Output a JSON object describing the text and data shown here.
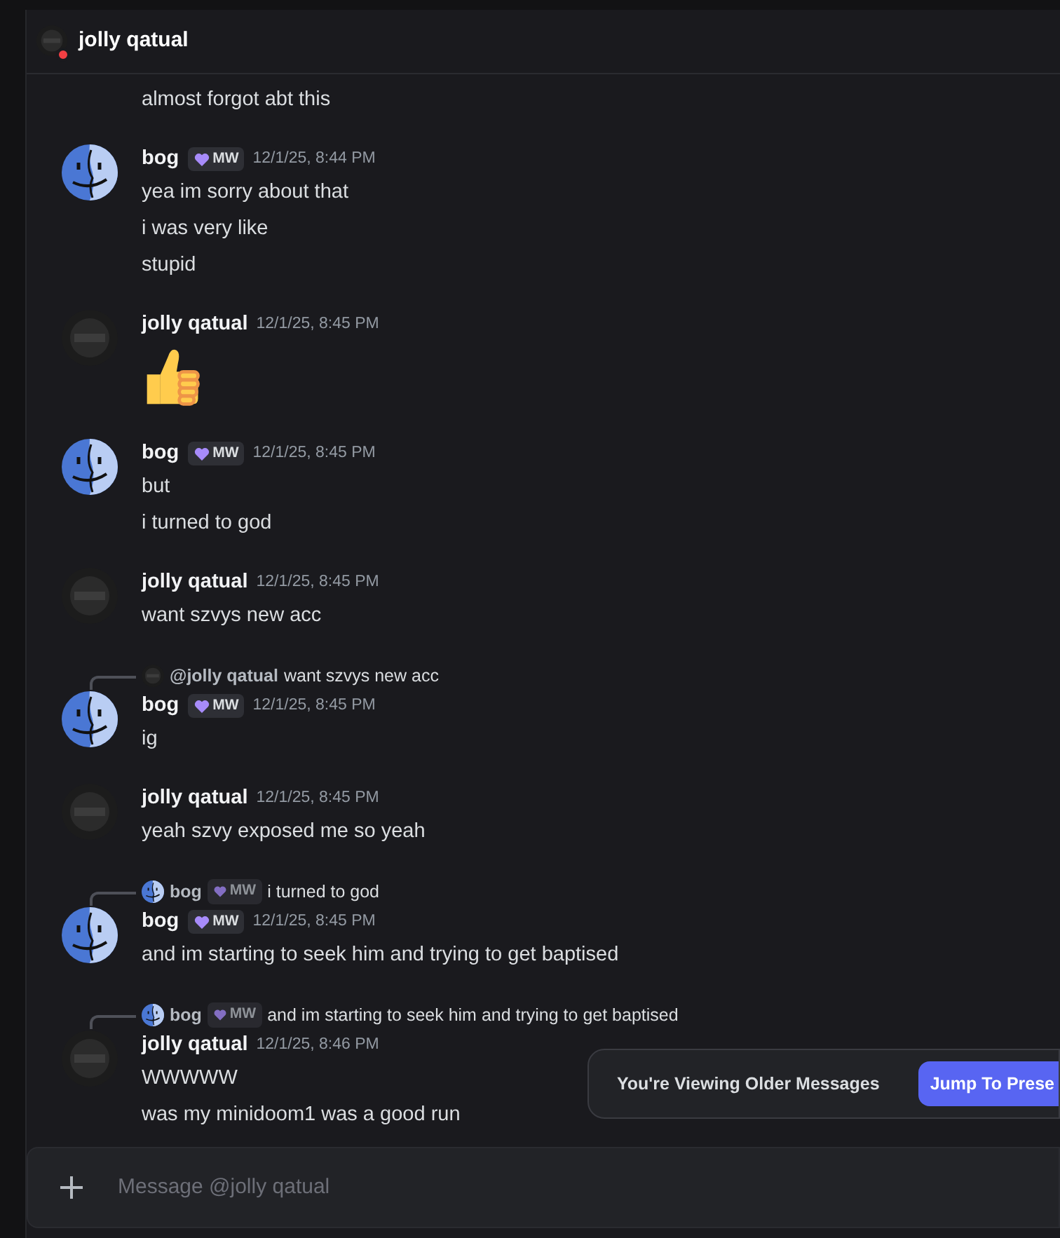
{
  "header": {
    "title": "jolly qatual",
    "avatar": {
      "kind": "dark"
    },
    "status": {
      "color": "#f23f43"
    }
  },
  "messages": [
    {
      "lines": [
        {
          "kind": "text",
          "text": "almost forgot abt this"
        }
      ]
    },
    {
      "author": "bog",
      "avatar": {
        "kind": "finder"
      },
      "badge": "MW",
      "time": "12/1/25, 8:44 PM",
      "lines": [
        {
          "kind": "text",
          "text": "yea im sorry about that"
        },
        {
          "kind": "text",
          "text": "i was very like"
        },
        {
          "kind": "text",
          "text": "stupid"
        }
      ]
    },
    {
      "author": "jolly qatual",
      "avatar": {
        "kind": "dark"
      },
      "time": "12/1/25, 8:45 PM",
      "lines": [
        {
          "kind": "emoji"
        }
      ]
    },
    {
      "author": "bog",
      "avatar": {
        "kind": "finder"
      },
      "badge": "MW",
      "time": "12/1/25, 8:45 PM",
      "lines": [
        {
          "kind": "text",
          "text": "but"
        },
        {
          "kind": "text",
          "text": "i turned to god"
        }
      ]
    },
    {
      "author": "jolly qatual",
      "avatar": {
        "kind": "dark"
      },
      "time": "12/1/25, 8:45 PM",
      "lines": [
        {
          "kind": "text",
          "text": "want szvys new acc"
        }
      ]
    },
    {
      "reply": {
        "avatar": {
          "kind": "dark"
        },
        "author": "@jolly qatual",
        "text": "want szvys new acc"
      },
      "author": "bog",
      "avatar": {
        "kind": "finder"
      },
      "badge": "MW",
      "time": "12/1/25, 8:45 PM",
      "lines": [
        {
          "kind": "text",
          "text": "ig"
        }
      ]
    },
    {
      "author": "jolly qatual",
      "avatar": {
        "kind": "dark"
      },
      "time": "12/1/25, 8:45 PM",
      "lines": [
        {
          "kind": "text",
          "text": "yeah szvy exposed me so yeah"
        }
      ]
    },
    {
      "reply": {
        "avatar": {
          "kind": "finder"
        },
        "author": "bog",
        "badge": "MW",
        "text": "i turned to god"
      },
      "author": "bog",
      "avatar": {
        "kind": "finder"
      },
      "badge": "MW",
      "time": "12/1/25, 8:45 PM",
      "lines": [
        {
          "kind": "text",
          "text": "and im starting to seek him and trying to get baptised"
        }
      ]
    },
    {
      "reply": {
        "avatar": {
          "kind": "finder"
        },
        "author": "bog",
        "badge": "MW",
        "text": "and im starting to seek him and trying to get baptised"
      },
      "author": "jolly qatual",
      "avatar": {
        "kind": "dark"
      },
      "time": "12/1/25, 8:46 PM",
      "lines": [
        {
          "kind": "text",
          "text": "WWWWW"
        },
        {
          "kind": "text",
          "text": "was my minidoom1 was a good run"
        }
      ]
    }
  ],
  "banner": {
    "text": "You're Viewing Older Messages",
    "button": "Jump To Prese"
  },
  "composer": {
    "placeholder": "Message @jolly qatual"
  }
}
